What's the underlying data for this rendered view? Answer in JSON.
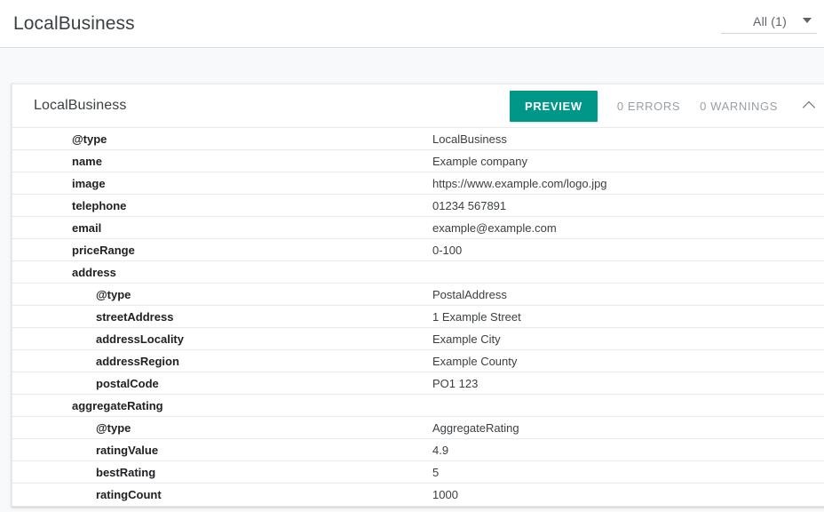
{
  "appbar": {
    "title": "LocalBusiness",
    "filter": {
      "label": "All (1)",
      "caret_icon": "chevron-down-icon"
    }
  },
  "card": {
    "title": "LocalBusiness",
    "preview_label": "PREVIEW",
    "errors_label": "0 ERRORS",
    "warnings_label": "0 WARNINGS",
    "collapse_icon": "chevron-up-icon",
    "accent_color": "#009688",
    "counter_color": "#9aa0a6",
    "rows": [
      {
        "level": 1,
        "key": "@type",
        "value": "LocalBusiness"
      },
      {
        "level": 1,
        "key": "name",
        "value": "Example company"
      },
      {
        "level": 1,
        "key": "image",
        "value": "https://www.example.com/logo.jpg"
      },
      {
        "level": 1,
        "key": "telephone",
        "value": "01234 567891"
      },
      {
        "level": 1,
        "key": "email",
        "value": "example@example.com"
      },
      {
        "level": 1,
        "key": "priceRange",
        "value": "0-100"
      },
      {
        "level": 1,
        "key": "address",
        "value": ""
      },
      {
        "level": 2,
        "key": "@type",
        "value": "PostalAddress"
      },
      {
        "level": 2,
        "key": "streetAddress",
        "value": "1 Example Street"
      },
      {
        "level": 2,
        "key": "addressLocality",
        "value": "Example City"
      },
      {
        "level": 2,
        "key": "addressRegion",
        "value": "Example County"
      },
      {
        "level": 2,
        "key": "postalCode",
        "value": "PO1 123"
      },
      {
        "level": 1,
        "key": "aggregateRating",
        "value": ""
      },
      {
        "level": 2,
        "key": "@type",
        "value": "AggregateRating"
      },
      {
        "level": 2,
        "key": "ratingValue",
        "value": "4.9"
      },
      {
        "level": 2,
        "key": "bestRating",
        "value": "5"
      },
      {
        "level": 2,
        "key": "ratingCount",
        "value": "1000"
      }
    ]
  }
}
